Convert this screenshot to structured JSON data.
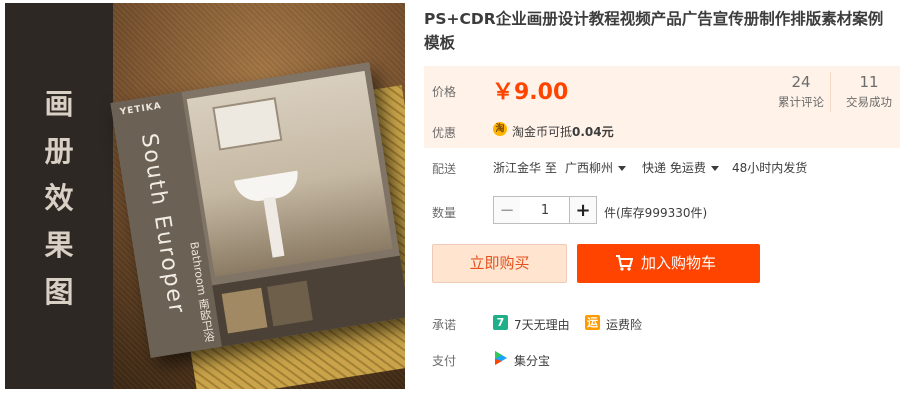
{
  "gallery": {
    "side_chars": [
      "画",
      "册",
      "效",
      "果",
      "图"
    ],
    "brochure": {
      "brand": "YETIKA",
      "title": "South Europer",
      "subtitle": "Bathroom 南欧卫浴"
    }
  },
  "product": {
    "title": "PS+CDR企业画册设计教程视频产品广告宣传册制作排版素材案例模板"
  },
  "price": {
    "label": "价格",
    "value": "￥9.00",
    "reviews_count": "24",
    "reviews_label": "累计评论",
    "deals_count": "11",
    "deals_label": "交易成功"
  },
  "promo": {
    "label": "优惠",
    "coin_icon_text": "淘",
    "text_prefix": "淘金币可抵",
    "text_amount": "0.04元"
  },
  "shipping": {
    "label": "配送",
    "from": "浙江金华 至",
    "to": "广西柳州",
    "method": "快递 免运费",
    "dispatch": "48小时内发货"
  },
  "quantity": {
    "label": "数量",
    "minus": "−",
    "value": "1",
    "plus": "+",
    "stock": "件(库存999330件)"
  },
  "actions": {
    "buy_now": "立即购买",
    "add_to_cart": "加入购物车"
  },
  "services": {
    "label": "承诺",
    "items": [
      {
        "badge": "7",
        "text": "7天无理由",
        "color": "#1fb08a"
      },
      {
        "badge": "运",
        "text": "运费险",
        "color": "#ff9a00"
      }
    ]
  },
  "payment": {
    "label": "支付",
    "method": "集分宝"
  },
  "colors": {
    "accent": "#ff4400",
    "price_bg": "#fff2e8"
  }
}
